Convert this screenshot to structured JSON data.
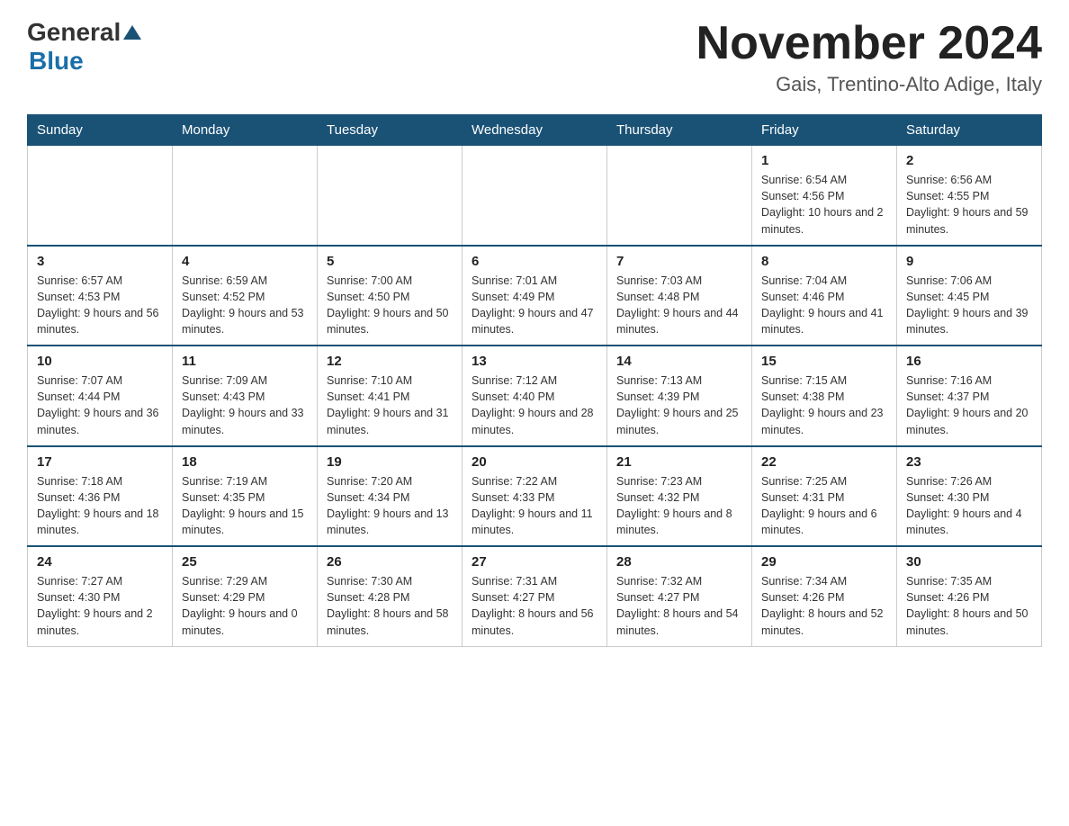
{
  "header": {
    "logo_general": "General",
    "logo_blue": "Blue",
    "month_title": "November 2024",
    "location": "Gais, Trentino-Alto Adige, Italy"
  },
  "days_of_week": [
    "Sunday",
    "Monday",
    "Tuesday",
    "Wednesday",
    "Thursday",
    "Friday",
    "Saturday"
  ],
  "weeks": [
    [
      {
        "day": "",
        "info": ""
      },
      {
        "day": "",
        "info": ""
      },
      {
        "day": "",
        "info": ""
      },
      {
        "day": "",
        "info": ""
      },
      {
        "day": "",
        "info": ""
      },
      {
        "day": "1",
        "info": "Sunrise: 6:54 AM\nSunset: 4:56 PM\nDaylight: 10 hours and 2 minutes."
      },
      {
        "day": "2",
        "info": "Sunrise: 6:56 AM\nSunset: 4:55 PM\nDaylight: 9 hours and 59 minutes."
      }
    ],
    [
      {
        "day": "3",
        "info": "Sunrise: 6:57 AM\nSunset: 4:53 PM\nDaylight: 9 hours and 56 minutes."
      },
      {
        "day": "4",
        "info": "Sunrise: 6:59 AM\nSunset: 4:52 PM\nDaylight: 9 hours and 53 minutes."
      },
      {
        "day": "5",
        "info": "Sunrise: 7:00 AM\nSunset: 4:50 PM\nDaylight: 9 hours and 50 minutes."
      },
      {
        "day": "6",
        "info": "Sunrise: 7:01 AM\nSunset: 4:49 PM\nDaylight: 9 hours and 47 minutes."
      },
      {
        "day": "7",
        "info": "Sunrise: 7:03 AM\nSunset: 4:48 PM\nDaylight: 9 hours and 44 minutes."
      },
      {
        "day": "8",
        "info": "Sunrise: 7:04 AM\nSunset: 4:46 PM\nDaylight: 9 hours and 41 minutes."
      },
      {
        "day": "9",
        "info": "Sunrise: 7:06 AM\nSunset: 4:45 PM\nDaylight: 9 hours and 39 minutes."
      }
    ],
    [
      {
        "day": "10",
        "info": "Sunrise: 7:07 AM\nSunset: 4:44 PM\nDaylight: 9 hours and 36 minutes."
      },
      {
        "day": "11",
        "info": "Sunrise: 7:09 AM\nSunset: 4:43 PM\nDaylight: 9 hours and 33 minutes."
      },
      {
        "day": "12",
        "info": "Sunrise: 7:10 AM\nSunset: 4:41 PM\nDaylight: 9 hours and 31 minutes."
      },
      {
        "day": "13",
        "info": "Sunrise: 7:12 AM\nSunset: 4:40 PM\nDaylight: 9 hours and 28 minutes."
      },
      {
        "day": "14",
        "info": "Sunrise: 7:13 AM\nSunset: 4:39 PM\nDaylight: 9 hours and 25 minutes."
      },
      {
        "day": "15",
        "info": "Sunrise: 7:15 AM\nSunset: 4:38 PM\nDaylight: 9 hours and 23 minutes."
      },
      {
        "day": "16",
        "info": "Sunrise: 7:16 AM\nSunset: 4:37 PM\nDaylight: 9 hours and 20 minutes."
      }
    ],
    [
      {
        "day": "17",
        "info": "Sunrise: 7:18 AM\nSunset: 4:36 PM\nDaylight: 9 hours and 18 minutes."
      },
      {
        "day": "18",
        "info": "Sunrise: 7:19 AM\nSunset: 4:35 PM\nDaylight: 9 hours and 15 minutes."
      },
      {
        "day": "19",
        "info": "Sunrise: 7:20 AM\nSunset: 4:34 PM\nDaylight: 9 hours and 13 minutes."
      },
      {
        "day": "20",
        "info": "Sunrise: 7:22 AM\nSunset: 4:33 PM\nDaylight: 9 hours and 11 minutes."
      },
      {
        "day": "21",
        "info": "Sunrise: 7:23 AM\nSunset: 4:32 PM\nDaylight: 9 hours and 8 minutes."
      },
      {
        "day": "22",
        "info": "Sunrise: 7:25 AM\nSunset: 4:31 PM\nDaylight: 9 hours and 6 minutes."
      },
      {
        "day": "23",
        "info": "Sunrise: 7:26 AM\nSunset: 4:30 PM\nDaylight: 9 hours and 4 minutes."
      }
    ],
    [
      {
        "day": "24",
        "info": "Sunrise: 7:27 AM\nSunset: 4:30 PM\nDaylight: 9 hours and 2 minutes."
      },
      {
        "day": "25",
        "info": "Sunrise: 7:29 AM\nSunset: 4:29 PM\nDaylight: 9 hours and 0 minutes."
      },
      {
        "day": "26",
        "info": "Sunrise: 7:30 AM\nSunset: 4:28 PM\nDaylight: 8 hours and 58 minutes."
      },
      {
        "day": "27",
        "info": "Sunrise: 7:31 AM\nSunset: 4:27 PM\nDaylight: 8 hours and 56 minutes."
      },
      {
        "day": "28",
        "info": "Sunrise: 7:32 AM\nSunset: 4:27 PM\nDaylight: 8 hours and 54 minutes."
      },
      {
        "day": "29",
        "info": "Sunrise: 7:34 AM\nSunset: 4:26 PM\nDaylight: 8 hours and 52 minutes."
      },
      {
        "day": "30",
        "info": "Sunrise: 7:35 AM\nSunset: 4:26 PM\nDaylight: 8 hours and 50 minutes."
      }
    ]
  ]
}
